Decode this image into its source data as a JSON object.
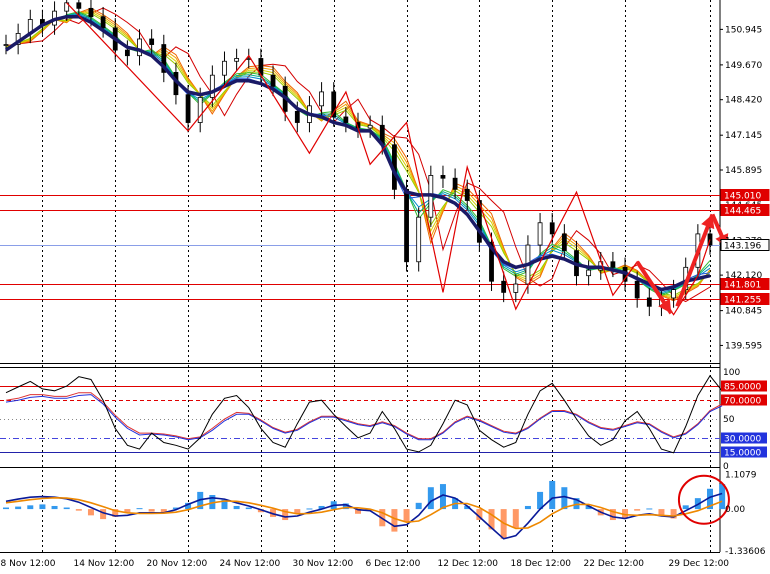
{
  "chart_data": [
    {
      "type": "line",
      "panel": "price",
      "title": "",
      "ylim": [
        139.0,
        152.0
      ],
      "y_ticks": [
        "150.945",
        "149.670",
        "148.420",
        "147.145",
        "145.895",
        "144.645",
        "143.370",
        "142.120",
        "140.845",
        "139.595"
      ],
      "level_labels": [
        "145.010",
        "144.465",
        "143.196",
        "141.801",
        "141.255"
      ],
      "levels": [
        {
          "value": 145.01,
          "kind": "resistance",
          "color": "#e00000"
        },
        {
          "value": 144.465,
          "kind": "resistance",
          "color": "#e00000"
        },
        {
          "value": 143.196,
          "kind": "current-price",
          "color": "#8a9ee8"
        },
        {
          "value": 141.801,
          "kind": "support",
          "color": "#e00000"
        },
        {
          "value": 141.255,
          "kind": "support",
          "color": "#e00000"
        }
      ],
      "ma_fan_colors": [
        "#d40000",
        "#ee6600",
        "#f0a000",
        "#d8d000",
        "#99cc00",
        "#33bb33",
        "#00aa88",
        "#0088cc",
        "#2255dd"
      ],
      "series": [
        {
          "key": "close",
          "color": "#000000",
          "values": [
            150.4,
            150.8,
            151.3,
            151.1,
            151.6,
            151.9,
            151.7,
            151.4,
            151.0,
            150.2,
            150.0,
            150.6,
            150.4,
            149.4,
            148.6,
            147.6,
            148.5,
            149.3,
            149.8,
            149.9,
            149.9,
            149.3,
            148.9,
            148.0,
            147.6,
            148.2,
            148.7,
            147.8,
            147.6,
            147.4,
            147.5,
            146.8,
            145.2,
            142.6,
            144.2,
            145.7,
            145.6,
            145.2,
            144.8,
            143.3,
            141.9,
            141.5,
            141.8,
            143.2,
            144.0,
            143.6,
            143.0,
            142.1,
            142.3,
            142.6,
            142.4,
            141.9,
            141.3,
            141.0,
            141.3,
            141.6,
            142.4,
            143.6,
            143.2
          ]
        },
        {
          "key": "slow-ma",
          "color": "#1a1a66",
          "values": [
            150.2,
            150.5,
            150.8,
            151.1,
            151.3,
            151.4,
            151.4,
            151.2,
            150.9,
            150.6,
            150.3,
            150.2,
            150.0,
            149.6,
            149.1,
            148.7,
            148.6,
            148.7,
            148.9,
            149.1,
            149.1,
            149.0,
            148.8,
            148.5,
            148.1,
            147.9,
            147.8,
            147.6,
            147.5,
            147.3,
            147.3,
            146.8,
            145.8,
            145.1,
            145.0,
            145.0,
            144.9,
            144.7,
            144.3,
            143.7,
            143.1,
            142.6,
            142.4,
            142.5,
            142.7,
            142.8,
            142.7,
            142.5,
            142.4,
            142.4,
            142.3,
            142.2,
            142.0,
            141.8,
            141.6,
            141.7,
            141.9,
            142.0,
            142.1
          ]
        }
      ],
      "zigzag": [
        {
          "i": 5,
          "y": 151.9
        },
        {
          "i": 15,
          "y": 147.3
        },
        {
          "i": 20,
          "y": 150.0
        },
        {
          "i": 25,
          "y": 146.5
        },
        {
          "i": 28,
          "y": 148.7
        },
        {
          "i": 30,
          "y": 146.1
        },
        {
          "i": 33,
          "y": 147.6
        },
        {
          "i": 36,
          "y": 141.5
        },
        {
          "i": 38,
          "y": 146.0
        },
        {
          "i": 42,
          "y": 140.9
        },
        {
          "i": 47,
          "y": 145.1
        },
        {
          "i": 50,
          "y": 141.4
        },
        {
          "i": 52,
          "y": 142.6
        },
        {
          "i": 55,
          "y": 140.7
        },
        {
          "i": 57,
          "y": 142.1
        },
        {
          "i": 58,
          "y": 143.4
        }
      ],
      "arrows": [
        {
          "from": {
            "i": 52.0,
            "y": 142.6
          },
          "to": {
            "i": 54.8,
            "y": 140.75
          }
        },
        {
          "from": {
            "i": 55.3,
            "y": 141.0
          },
          "to": {
            "i": 58.2,
            "y": 144.3
          }
        },
        {
          "from": {
            "i": 58.2,
            "y": 144.3
          },
          "to": {
            "i": 59.4,
            "y": 143.1
          }
        }
      ]
    },
    {
      "type": "line",
      "panel": "stochastic",
      "ylim": [
        0,
        100
      ],
      "y_ticks": [
        "100",
        "50",
        "0"
      ],
      "level_labels": [
        "85.0000",
        "70.0000",
        "30.0000",
        "15.0000"
      ],
      "levels": [
        {
          "value": 85,
          "color": "#e00000",
          "style": "solid"
        },
        {
          "value": 70,
          "color": "#e00000",
          "style": "dash"
        },
        {
          "value": 50,
          "color": "#888888",
          "style": "dot"
        },
        {
          "value": 30,
          "color": "#4444dd",
          "style": "dashdot"
        },
        {
          "value": 15,
          "color": "#2222aa",
          "style": "solid"
        }
      ],
      "series": [
        {
          "key": "main",
          "color": "#000000",
          "values": [
            78,
            84,
            90,
            82,
            80,
            85,
            95,
            92,
            70,
            40,
            22,
            18,
            35,
            25,
            22,
            18,
            30,
            55,
            72,
            75,
            62,
            40,
            25,
            20,
            45,
            68,
            70,
            55,
            42,
            30,
            35,
            58,
            40,
            18,
            15,
            22,
            45,
            70,
            65,
            38,
            28,
            20,
            25,
            55,
            80,
            88,
            70,
            50,
            32,
            22,
            28,
            48,
            58,
            40,
            18,
            14,
            42,
            75,
            96,
            80
          ]
        },
        {
          "key": "signal",
          "color": "#2233dd",
          "values": [
            68,
            70,
            73,
            74,
            72,
            72,
            75,
            76,
            66,
            52,
            40,
            33,
            34,
            33,
            31,
            28,
            30,
            38,
            48,
            55,
            55,
            48,
            40,
            35,
            38,
            46,
            52,
            52,
            48,
            44,
            42,
            46,
            42,
            34,
            28,
            28,
            35,
            46,
            52,
            48,
            42,
            36,
            34,
            40,
            50,
            58,
            58,
            54,
            46,
            40,
            38,
            42,
            46,
            44,
            36,
            30,
            34,
            44,
            58,
            64
          ]
        },
        {
          "key": "smooth",
          "color": "#dd3333",
          "values": [
            70,
            72,
            76,
            76,
            74,
            74,
            78,
            78,
            68,
            54,
            42,
            35,
            35,
            34,
            32,
            29,
            31,
            40,
            50,
            57,
            56,
            49,
            41,
            36,
            39,
            47,
            53,
            53,
            49,
            45,
            43,
            47,
            43,
            35,
            29,
            29,
            36,
            47,
            53,
            49,
            43,
            37,
            35,
            41,
            51,
            59,
            59,
            55,
            47,
            41,
            39,
            43,
            47,
            45,
            37,
            31,
            35,
            45,
            59,
            66
          ]
        }
      ]
    },
    {
      "type": "bar",
      "panel": "macd",
      "ylim": [
        -1.34,
        1.25
      ],
      "y_ticks": [
        "1.1079",
        "0.00",
        "-1.33606"
      ],
      "histogram": [
        0.05,
        0.08,
        0.12,
        0.15,
        0.1,
        0.05,
        -0.05,
        -0.2,
        -0.32,
        -0.25,
        -0.1,
        0.03,
        -0.08,
        -0.12,
        0.05,
        0.2,
        0.55,
        0.45,
        0.3,
        0.1,
        0.05,
        -0.1,
        -0.25,
        -0.35,
        -0.15,
        0.02,
        0.1,
        0.25,
        0.18,
        -0.15,
        -0.05,
        -0.55,
        -0.72,
        -0.4,
        0.2,
        0.7,
        0.8,
        0.35,
        0.1,
        -0.35,
        -0.65,
        -0.95,
        -0.6,
        0.1,
        0.55,
        0.9,
        0.7,
        0.35,
        0.1,
        -0.2,
        -0.35,
        -0.3,
        -0.05,
        0.02,
        -0.2,
        -0.3,
        0.12,
        0.35,
        0.65,
        0.8
      ],
      "colors": {
        "positive": "#3399ee",
        "negative": "#ff9966"
      },
      "series": [
        {
          "key": "macd",
          "color": "#0a1a99",
          "values": [
            0.25,
            0.32,
            0.38,
            0.4,
            0.38,
            0.33,
            0.22,
            0.05,
            -0.12,
            -0.22,
            -0.2,
            -0.12,
            -0.12,
            -0.12,
            -0.02,
            0.15,
            0.3,
            0.36,
            0.32,
            0.2,
            0.1,
            -0.02,
            -0.15,
            -0.25,
            -0.22,
            -0.1,
            0.0,
            0.12,
            0.14,
            -0.02,
            -0.05,
            -0.3,
            -0.55,
            -0.5,
            -0.2,
            0.25,
            0.45,
            0.35,
            0.1,
            -0.25,
            -0.6,
            -0.95,
            -0.85,
            -0.45,
            0.0,
            0.35,
            0.4,
            0.3,
            0.1,
            -0.1,
            -0.25,
            -0.3,
            -0.2,
            -0.15,
            -0.22,
            -0.25,
            -0.05,
            0.15,
            0.38,
            0.5
          ]
        },
        {
          "key": "signal",
          "color": "#ee8800",
          "values": [
            0.2,
            0.25,
            0.3,
            0.34,
            0.36,
            0.35,
            0.3,
            0.2,
            0.08,
            -0.05,
            -0.12,
            -0.14,
            -0.14,
            -0.13,
            -0.1,
            -0.02,
            0.1,
            0.2,
            0.26,
            0.25,
            0.2,
            0.12,
            0.03,
            -0.08,
            -0.15,
            -0.14,
            -0.1,
            -0.02,
            0.05,
            0.04,
            0.0,
            -0.12,
            -0.3,
            -0.42,
            -0.38,
            -0.18,
            0.05,
            0.18,
            0.18,
            0.05,
            -0.18,
            -0.45,
            -0.62,
            -0.6,
            -0.42,
            -0.15,
            0.05,
            0.15,
            0.15,
            0.05,
            -0.08,
            -0.18,
            -0.2,
            -0.18,
            -0.2,
            -0.22,
            -0.15,
            -0.05,
            0.1,
            0.25
          ]
        }
      ],
      "annotation": {
        "shape": "circle",
        "color": "#e00000",
        "target_index": 57.5
      }
    }
  ],
  "x_labels": [
    "8 Nov 12:00",
    "14 Nov 12:00",
    "20 Nov 12:00",
    "24 Nov 12:00",
    "30 Nov 12:00",
    "6 Dec 12:00",
    "12 Dec 12:00",
    "18 Dec 12:00",
    "22 Dec 12:00",
    "29 Dec 12:00"
  ],
  "x_label_index": [
    3,
    9,
    15,
    21,
    27,
    33,
    39,
    45,
    51,
    58
  ]
}
